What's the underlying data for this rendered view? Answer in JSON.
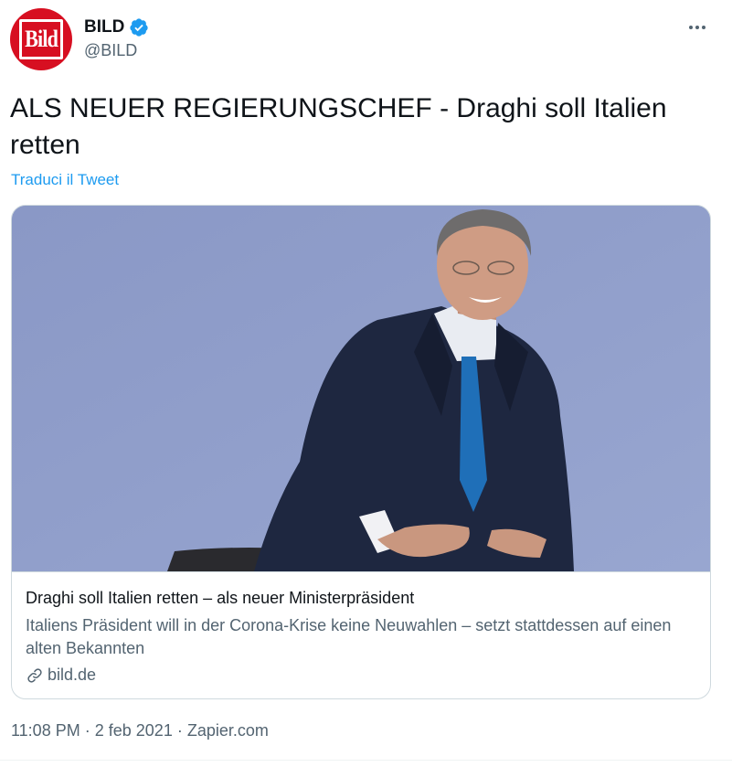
{
  "author": {
    "display_name": "BILD",
    "handle": "@BILD",
    "avatar_logo_text": "Bild",
    "verified_icon": "verified-badge-icon"
  },
  "tweet": {
    "text": "ALS NEUER REGIERUNGSCHEF - Draghi soll Italien retten",
    "translate_label": "Traduci il Tweet"
  },
  "card": {
    "title": "Draghi soll Italien retten – als neuer Ministerpräsident",
    "description": "Italiens Präsident will in der Corona-Krise keine Neuwahlen – setzt stattdessen auf einen alten Bekannten",
    "domain": "bild.de",
    "domain_icon": "link-icon"
  },
  "meta": {
    "time": "11:08 PM",
    "separator": "·",
    "date": "2 feb 2021",
    "source": "Zapier.com"
  },
  "colors": {
    "accent": "#1d9bf0",
    "brand_red": "#d70f21",
    "secondary_text": "#536471",
    "image_background": "#8e9dc9"
  }
}
